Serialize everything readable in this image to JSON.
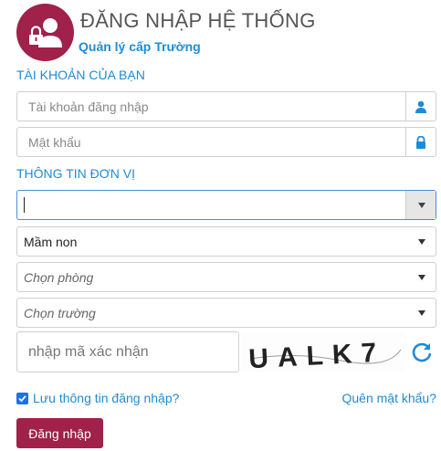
{
  "header": {
    "title": "ĐĂNG NHẬP HỆ THỐNG",
    "subtitle": "Quản lý cấp Trường"
  },
  "account_section": {
    "heading": "TÀI KHOẢN CỦA BẠN",
    "username_placeholder": "Tài khoản đăng nhập",
    "password_placeholder": "Mật khẩu"
  },
  "unit_section": {
    "heading": "THÔNG TIN ĐƠN VỊ",
    "first_select_value": "",
    "level_select_value": "Mầm non",
    "room_select_placeholder": "Chọn phòng",
    "school_select_placeholder": "Chọn trường"
  },
  "captcha": {
    "placeholder": "nhập mã xác nhận",
    "image_text": "UALK7"
  },
  "footer": {
    "remember_label": "Lưu thông tin đăng nhập?",
    "remember_checked": true,
    "forgot_label": "Quên mật khẩu?",
    "login_label": "Đăng nhập"
  },
  "colors": {
    "brand": "#a0214a",
    "accent": "#1e8bd6"
  },
  "icons": [
    "user-lock-icon",
    "user-icon",
    "lock-icon",
    "refresh-icon",
    "checkbox-icon"
  ]
}
